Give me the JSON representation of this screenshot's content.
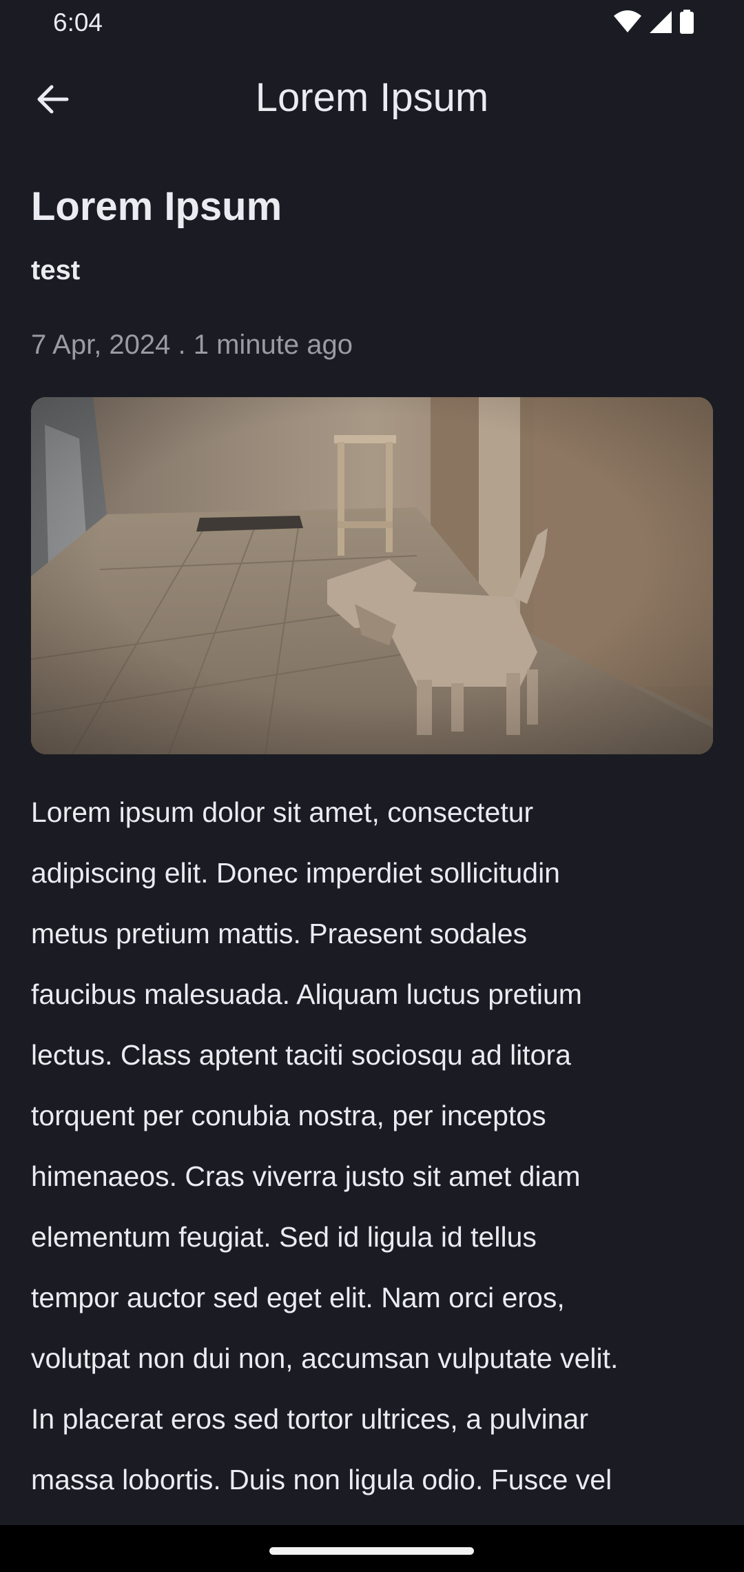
{
  "status_bar": {
    "time": "6:04",
    "icons": [
      "wifi-icon",
      "signal-icon",
      "battery-icon"
    ]
  },
  "app_bar": {
    "back_icon": "arrow-left-icon",
    "title": "Lorem Ipsum"
  },
  "article": {
    "title": "Lorem Ipsum",
    "subtitle": "test",
    "meta": "7 Apr, 2024 . 1 minute ago",
    "body_lines": [
      "Lorem ipsum dolor sit amet, consectetur",
      "adipiscing elit. Donec imperdiet sollicitudin",
      "metus pretium mattis. Praesent sodales",
      "faucibus malesuada. Aliquam luctus pretium",
      "lectus. Class aptent taciti sociosqu ad litora",
      "torquent per conubia nostra, per inceptos",
      "himenaeos. Cras viverra justo sit amet diam",
      "elementum feugiat. Sed id ligula id tellus",
      "tempor auctor sed eget elit. Nam orci eros,",
      "volutpat non dui non, accumsan vulputate velit.",
      "In placerat eros sed tortor ultrices, a pulvinar",
      "massa lobortis. Duis non ligula odio. Fusce vel"
    ]
  },
  "colors": {
    "background": "#1b1c23",
    "text_primary": "#ecebf1",
    "text_secondary": "#9c9ba3",
    "nav_bar": "#000000"
  }
}
